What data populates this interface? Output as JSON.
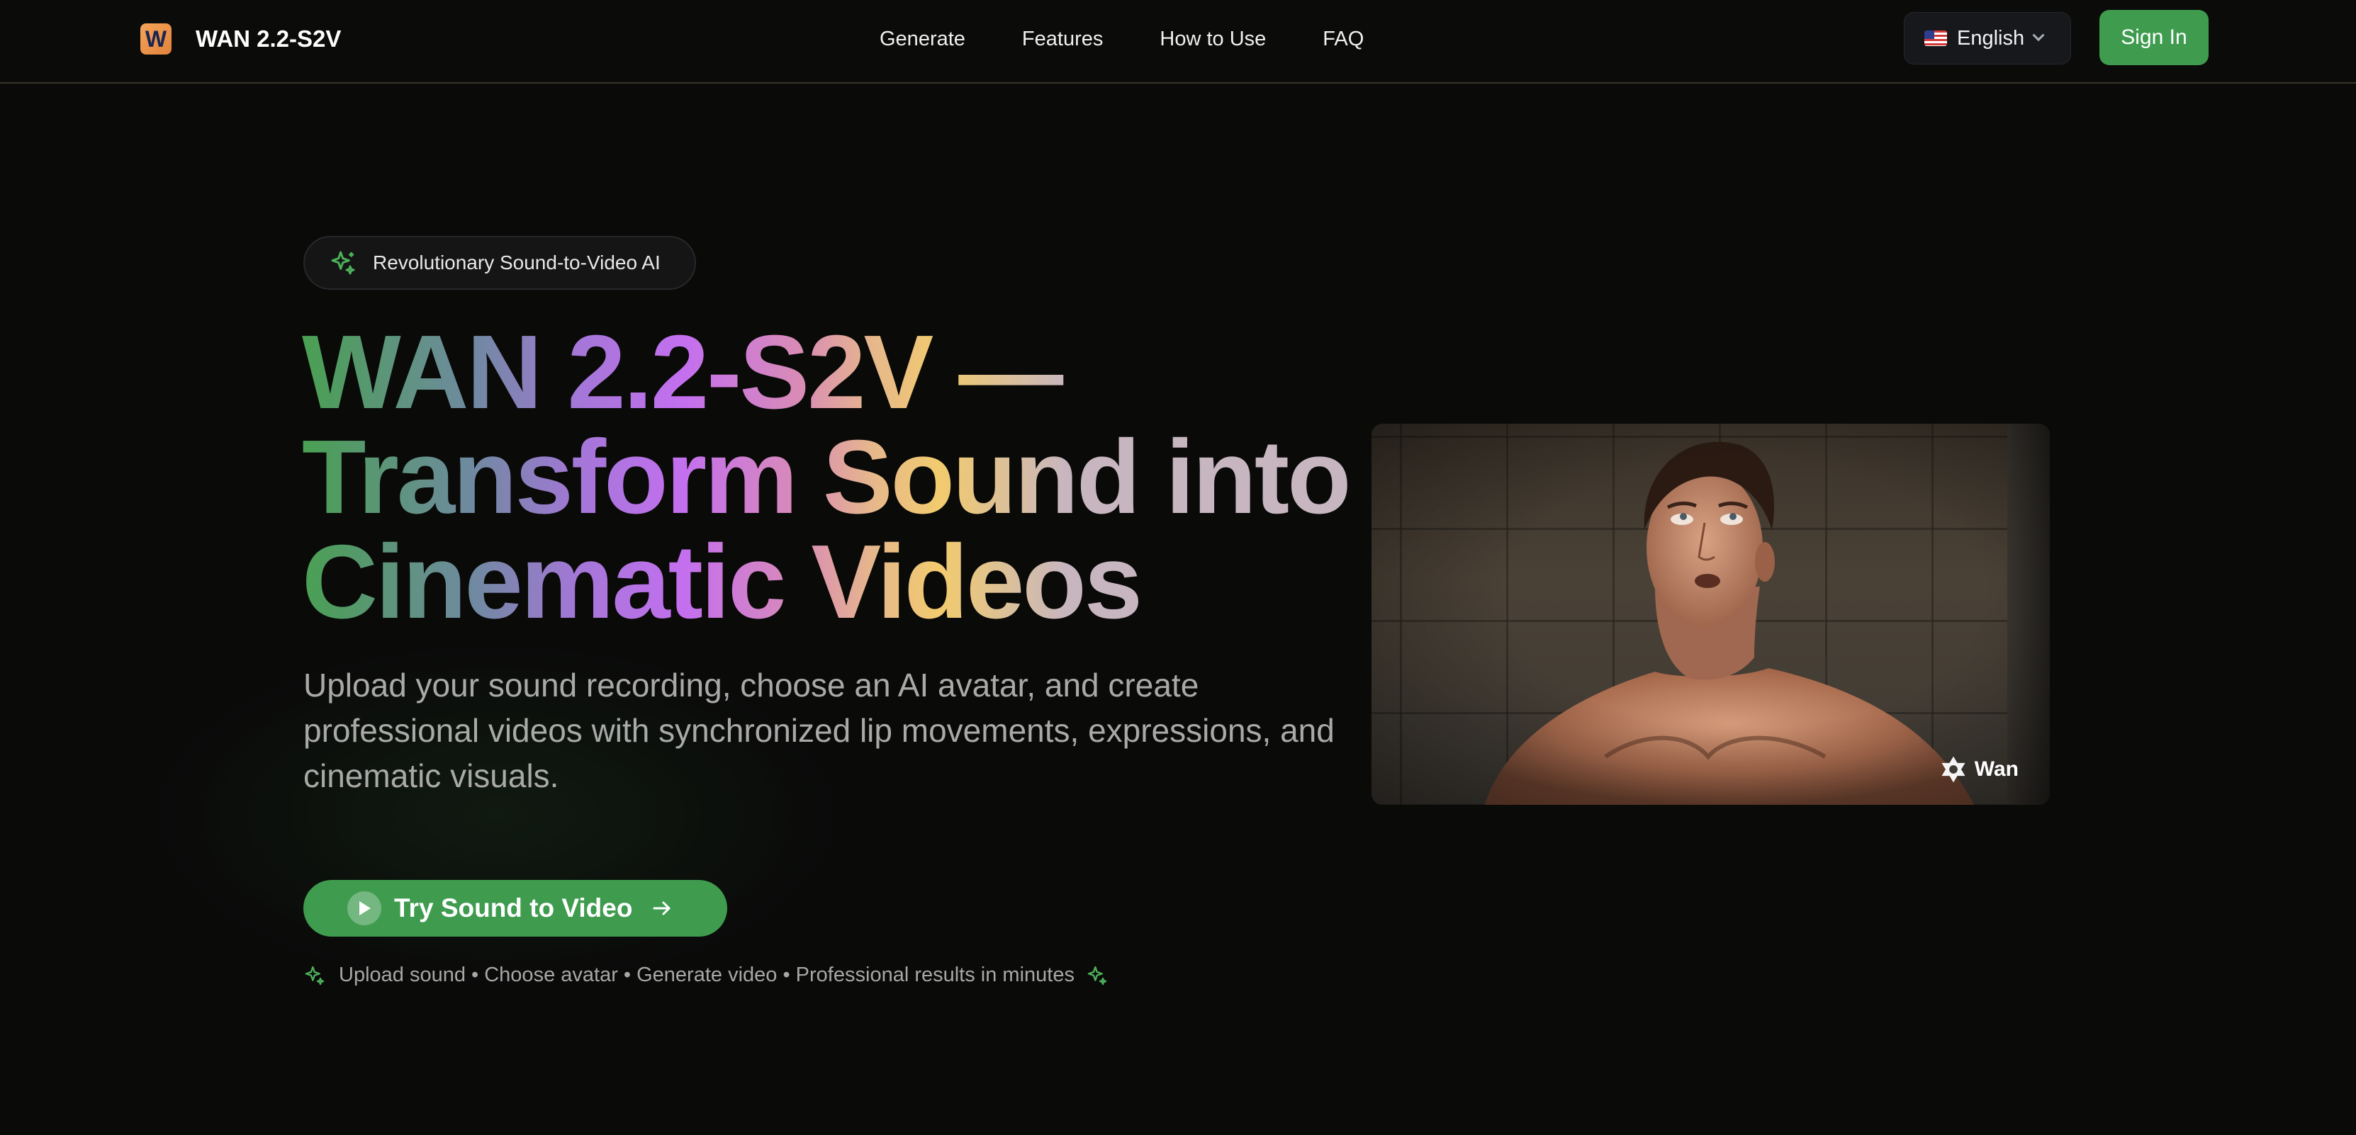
{
  "header": {
    "logo_letter": "W",
    "brand": "WAN 2.2-S2V",
    "nav": [
      "Generate",
      "Features",
      "How to Use",
      "FAQ"
    ],
    "language": "English",
    "sign_in": "Sign In"
  },
  "hero": {
    "badge": "Revolutionary Sound-to-Video AI",
    "headline": [
      "WAN 2.2-S2V —",
      "Transform Sound into",
      "Cinematic Videos"
    ],
    "subtitle": "Upload your sound recording, choose an AI avatar, and create professional videos with synchronized lip movements, expressions, and cinematic visuals.",
    "cta": "Try Sound to Video",
    "steps": "Upload sound • Choose avatar • Generate video • Professional results in minutes"
  },
  "video": {
    "watermark": "Wan"
  },
  "colors": {
    "accent_green": "#3f9c4f",
    "background": "#0a0a09",
    "gradient_purple": "#c46fef",
    "gradient_yellow": "#f2cb6e"
  }
}
